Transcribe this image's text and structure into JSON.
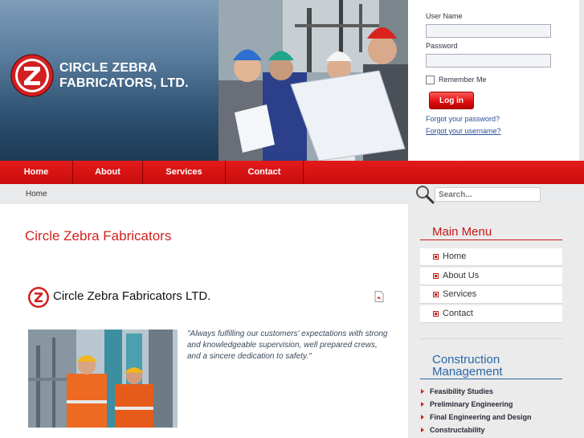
{
  "brand": {
    "name_line1": "CIRCLE ZEBRA",
    "name_line2": "FABRICATORS, LTD.",
    "logo_letter": "Z",
    "accent_color": "#d31f1f"
  },
  "login": {
    "username_label": "User Name",
    "username_value": "",
    "password_label": "Password",
    "password_value": "",
    "remember_label": "Remember Me",
    "remember_checked": false,
    "login_button": "Log in",
    "forgot_password": "Forgot your password?",
    "forgot_username": "Forgot your username?"
  },
  "nav": {
    "items": [
      "Home",
      "About",
      "Services",
      "Contact"
    ]
  },
  "breadcrumb": {
    "current": "Home"
  },
  "search": {
    "placeholder": "Search..."
  },
  "main": {
    "page_title": "Circle Zebra Fabricators",
    "article_title": "Circle Zebra Fabricators LTD.",
    "quote": "\"Always fulfilling our customers' expectations with strong and knowledgeable supervision, well prepared crews, and a sincere dedication to safety.\""
  },
  "sidebar": {
    "main_menu_title": "Main Menu",
    "main_menu_items": [
      "Home",
      "About Us",
      "Services",
      "Contact"
    ],
    "cm_title_line1": "Construction",
    "cm_title_line2": "Management",
    "cm_items": [
      "Feasibility Studies",
      "Preliminary Engineering",
      "Final Engineering and Design",
      "Constructability"
    ]
  },
  "icons": [
    "circle-z-logo-icon",
    "search-icon",
    "pdf-icon",
    "menu-bullet-icon",
    "arrow-right-icon"
  ]
}
